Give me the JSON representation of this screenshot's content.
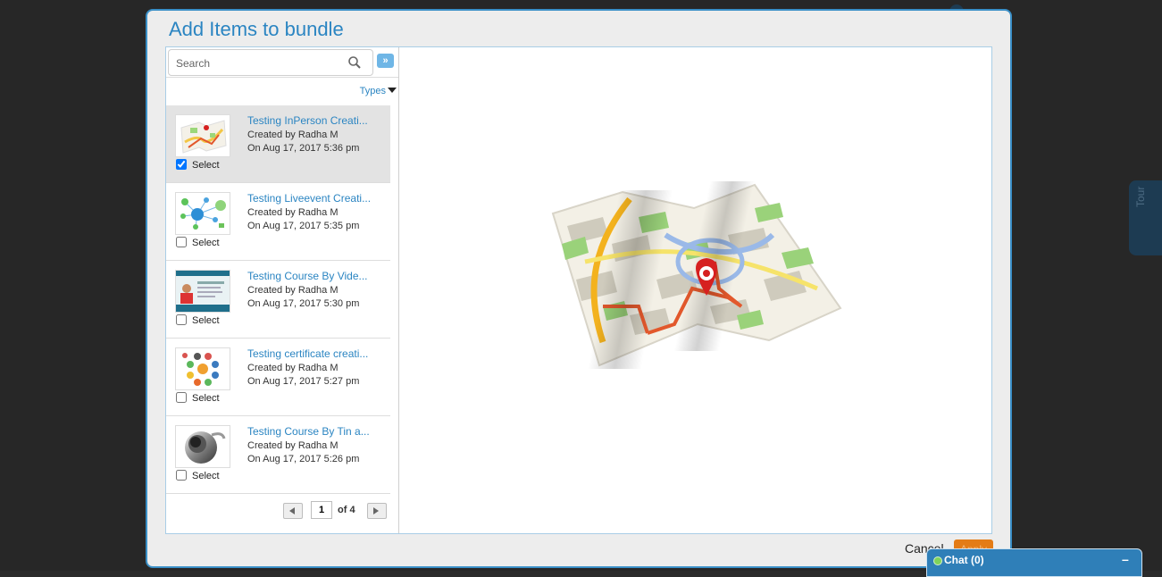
{
  "modal": {
    "title": "Add Items to bundle",
    "search_placeholder": "Search",
    "types_label": "Types",
    "cancel_label": "Cancel",
    "apply_label": "Apply"
  },
  "items": [
    {
      "title": "Testing InPerson Creati...",
      "created_by": "Created by Radha M",
      "date": "On Aug 17, 2017 5:36 pm",
      "select_label": "Select",
      "checked": true,
      "thumb": "map-thumbnail"
    },
    {
      "title": "Testing Liveevent Creati...",
      "created_by": "Created by Radha M",
      "date": "On Aug 17, 2017 5:35 pm",
      "select_label": "Select",
      "checked": false,
      "thumb": "network-thumbnail"
    },
    {
      "title": "Testing Course By Vide...",
      "created_by": "Created by Radha M",
      "date": "On Aug 17, 2017 5:30 pm",
      "select_label": "Select",
      "checked": false,
      "thumb": "video-tutorial-thumbnail"
    },
    {
      "title": "Testing certificate creati...",
      "created_by": "Created by Radha M",
      "date": "On Aug 17, 2017 5:27 pm",
      "select_label": "Select",
      "checked": false,
      "thumb": "social-icons-thumbnail"
    },
    {
      "title": "Testing Course By Tin a...",
      "created_by": "Created by Radha M",
      "date": "On Aug 17, 2017 5:26 pm",
      "select_label": "Select",
      "checked": false,
      "thumb": "tin-can-thumbnail"
    }
  ],
  "pager": {
    "current_page": "1",
    "of_label": "of 4"
  },
  "side": {
    "tour_label": "Tour"
  },
  "chat": {
    "label": "Chat  (0)",
    "minimize": "–"
  },
  "colors": {
    "accent": "#2b85c2",
    "apply": "#e47c16",
    "chat": "#2f7fb8"
  }
}
